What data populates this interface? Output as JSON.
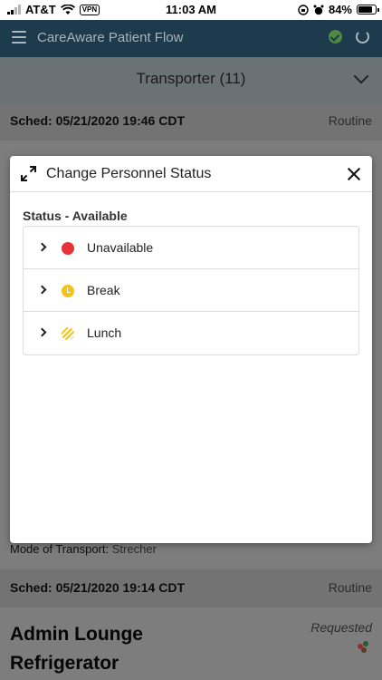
{
  "status_bar": {
    "carrier": "AT&T",
    "vpn": "VPN",
    "time": "11:03 AM",
    "battery": "84%"
  },
  "app": {
    "title": "CareAware Patient Flow"
  },
  "transporter": {
    "label": "Transporter (11)"
  },
  "cards": [
    {
      "sched": "Sched: 05/21/2020 19:46 CDT",
      "priority": "Routine"
    },
    {
      "mode_label": "Mode of Transport:",
      "mode_value": "Strecher"
    },
    {
      "sched": "Sched: 05/21/2020 19:14 CDT",
      "priority": "Routine",
      "location": "Admin Lounge Refrigerator",
      "status": "Requested"
    }
  ],
  "modal": {
    "title": "Change Personnel Status",
    "status_label": "Status - Available",
    "options": [
      {
        "label": "Unavailable",
        "icon": "red-dot-icon",
        "color": "#e8323a"
      },
      {
        "label": "Break",
        "icon": "clock-icon",
        "color": "#f2c318"
      },
      {
        "label": "Lunch",
        "icon": "striped-circle-icon",
        "color": "#f2c318"
      }
    ]
  },
  "colors": {
    "header": "#1e3a4d",
    "overlay": "#7d7d7d",
    "accent_green": "#4e8a3f"
  }
}
